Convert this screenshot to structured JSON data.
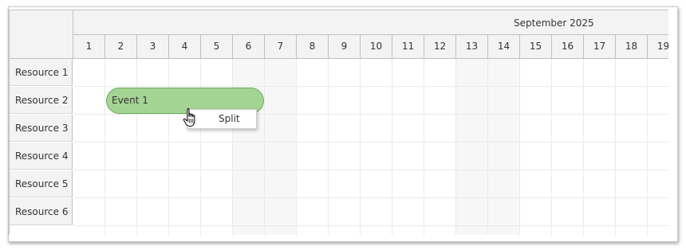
{
  "scheduler": {
    "month_label": "September 2025",
    "days": [
      "1",
      "2",
      "3",
      "4",
      "5",
      "6",
      "7",
      "8",
      "9",
      "10",
      "11",
      "12",
      "13",
      "14",
      "15",
      "16",
      "17",
      "18",
      "19"
    ],
    "resources": [
      "Resource 1",
      "Resource 2",
      "Resource 3",
      "Resource 4",
      "Resource 5",
      "Resource 6"
    ],
    "weekend_days": [
      "6",
      "7",
      "13",
      "14"
    ]
  },
  "event": {
    "text": "Event 1",
    "resource": "Resource 2",
    "start_day": "2",
    "end_day": "6",
    "color": "#a4d494",
    "border_color": "#6aaa5a"
  },
  "context_menu": {
    "items": [
      {
        "label": "Split"
      }
    ]
  },
  "colors": {
    "header_bg": "#f3f3f3",
    "grid_line": "#eaeaea",
    "weekend_bg": "#f7f7f7"
  },
  "cursor": {
    "icon": "hand-pointer-icon"
  }
}
